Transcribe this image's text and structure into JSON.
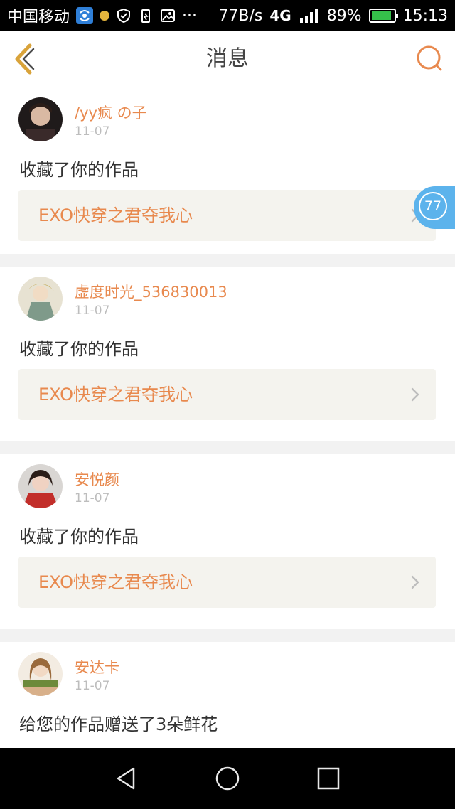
{
  "status_bar": {
    "carrier": "中国移动",
    "speed": "77B/s",
    "network": "4G",
    "battery": "89%",
    "battery_level": 0.89,
    "time": "15:13"
  },
  "header": {
    "title": "消息"
  },
  "floating_badge": {
    "count": "77"
  },
  "messages": [
    {
      "username": "/yy疯 の子",
      "date": "11-07",
      "action": "收藏了你的作品",
      "work_title": "EXO快穿之君夺我心",
      "avatar_color": "#3a2a2a"
    },
    {
      "username": "虚度时光_536830013",
      "date": "11-07",
      "action": "收藏了你的作品",
      "work_title": "EXO快穿之君夺我心",
      "avatar_color": "#c9c3a6"
    },
    {
      "username": "安悦颜",
      "date": "11-07",
      "action": "收藏了你的作品",
      "work_title": "EXO快穿之君夺我心",
      "avatar_color": "#b8322c"
    },
    {
      "username": "安达卡",
      "date": "11-07",
      "action": "给您的作品赠送了3朵鲜花",
      "work_title": "",
      "avatar_color": "#d8b08a"
    }
  ],
  "colors": {
    "accent": "#e8894e",
    "back_icon": "#d9a33a",
    "badge": "#5cb3ec"
  },
  "icons": {
    "back": "chevron-left-icon",
    "search": "search-icon",
    "work_arrow": "chevron-right-icon",
    "nav_back": "triangle-back-icon",
    "nav_home": "circle-home-icon",
    "nav_recent": "square-recents-icon"
  }
}
